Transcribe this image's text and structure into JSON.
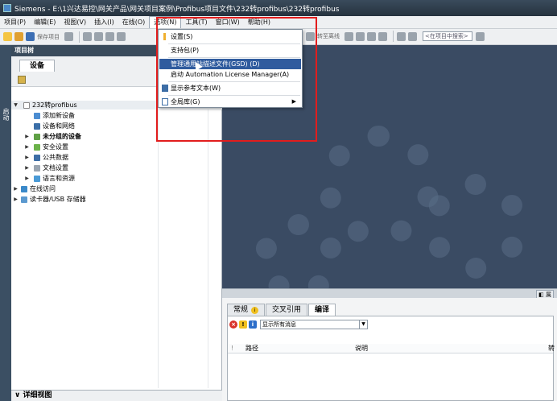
{
  "window": {
    "title": "Siemens  -  E:\\1兴达易控\\网关产品\\网关项目案例\\Profibus项目文件\\232转profibus\\232转profibus"
  },
  "menubar": {
    "items": [
      "项目(P)",
      "编辑(E)",
      "视图(V)",
      "插入(I)",
      "在线(O)",
      "选项(N)",
      "工具(T)",
      "窗口(W)",
      "帮助(H)"
    ],
    "active_index": 5
  },
  "toolbar": {
    "save_project_label": "保存项目",
    "go_offline_label": "转至离线",
    "search_placeholder": "<在项目中搜索>"
  },
  "options_menu": {
    "items": [
      {
        "label": "设置(S)",
        "icon": "settings-icon"
      },
      {
        "label": "支持包(P)",
        "icon": ""
      },
      {
        "label": "管理通用站描述文件(GSD) (D)",
        "icon": "",
        "highlighted": true
      },
      {
        "label": "启动 Automation License Manager(A)",
        "icon": ""
      },
      {
        "label": "显示参考文本(W)",
        "icon": "reference-text-icon"
      },
      {
        "label": "全局库(G)",
        "icon": "global-library-icon",
        "submenu": true
      }
    ]
  },
  "side_strip": {
    "label": "启动"
  },
  "project_tree": {
    "header": "项目树",
    "tab": "设备",
    "nodes": [
      {
        "label": "232转profibus",
        "level": 0,
        "expanded": true,
        "icon": "project-icon"
      },
      {
        "label": "添加新设备",
        "level": 1,
        "icon": "add-device-icon"
      },
      {
        "label": "设备和网络",
        "level": 1,
        "icon": "network-icon"
      },
      {
        "label": "未分组的设备",
        "level": 1,
        "collapsed": true,
        "bold": true,
        "icon": "folder-icon"
      },
      {
        "label": "安全设置",
        "level": 1,
        "collapsed": true,
        "icon": "security-icon"
      },
      {
        "label": "公共数据",
        "level": 1,
        "collapsed": true,
        "icon": "common-data-icon"
      },
      {
        "label": "文档设置",
        "level": 1,
        "collapsed": true,
        "icon": "document-icon"
      },
      {
        "label": "语言和资源",
        "level": 1,
        "collapsed": true,
        "icon": "language-icon"
      },
      {
        "label": "在线访问",
        "level": 0,
        "collapsed": true,
        "icon": "online-icon"
      },
      {
        "label": "读卡器/USB 存储器",
        "level": 0,
        "collapsed": true,
        "icon": "card-reader-icon"
      }
    ]
  },
  "detail_view": {
    "label": "详细视图"
  },
  "inspector": {
    "tabs": [
      "常规",
      "交叉引用",
      "编译"
    ],
    "active_tab": 2,
    "filter": "显示所有消息",
    "columns": [
      "路径",
      "说明",
      "转"
    ]
  }
}
